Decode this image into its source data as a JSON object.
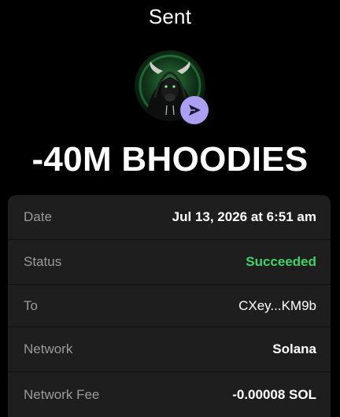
{
  "header": {
    "title": "Sent"
  },
  "token": {
    "avatar_icon": "bull-hoodie-avatar-icon",
    "badge_icon": "send-arrow-icon",
    "amount": "-40M BHOODIES"
  },
  "colors": {
    "background": "#000000",
    "card": "#1e1e1e",
    "label": "#9a9a9a",
    "success": "#3bd468",
    "badge": "#ab9ff2"
  },
  "details": [
    {
      "label": "Date",
      "value": "Jul 13, 2026 at 6:51 am"
    },
    {
      "label": "Status",
      "value": "Succeeded"
    },
    {
      "label": "To",
      "value": "CXey...KM9b"
    },
    {
      "label": "Network",
      "value": "Solana"
    },
    {
      "label": "Network Fee",
      "value": "-0.00008 SOL"
    }
  ]
}
